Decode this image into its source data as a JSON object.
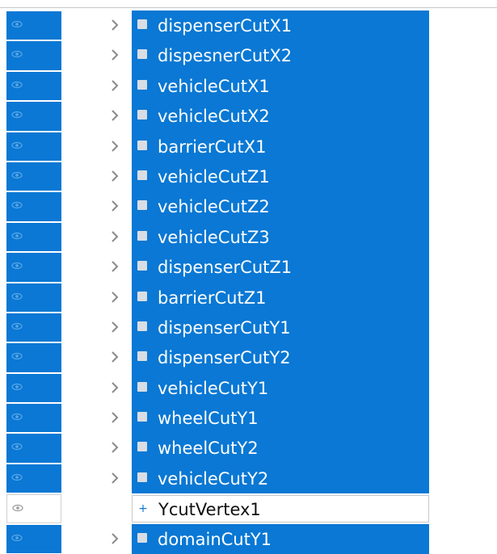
{
  "colors": {
    "selection": "#0a78d4",
    "text_selected": "#ffffff",
    "text_normal": "#111111"
  },
  "tree": {
    "items": [
      {
        "label": "dispenserCutX1",
        "icon": "cut-plane-icon",
        "selected": true,
        "expandable": true
      },
      {
        "label": "dispesnerCutX2",
        "icon": "cut-plane-icon",
        "selected": true,
        "expandable": true
      },
      {
        "label": "vehicleCutX1",
        "icon": "cut-plane-icon",
        "selected": true,
        "expandable": true
      },
      {
        "label": "vehicleCutX2",
        "icon": "cut-plane-icon",
        "selected": true,
        "expandable": true
      },
      {
        "label": "barrierCutX1",
        "icon": "cut-plane-icon",
        "selected": true,
        "expandable": true
      },
      {
        "label": "vehicleCutZ1",
        "icon": "cut-plane-icon",
        "selected": true,
        "expandable": true
      },
      {
        "label": "vehicleCutZ2",
        "icon": "cut-plane-icon",
        "selected": true,
        "expandable": true
      },
      {
        "label": "vehicleCutZ3",
        "icon": "cut-plane-icon",
        "selected": true,
        "expandable": true
      },
      {
        "label": "dispenserCutZ1",
        "icon": "cut-plane-icon",
        "selected": true,
        "expandable": true
      },
      {
        "label": "barrierCutZ1",
        "icon": "cut-plane-icon",
        "selected": true,
        "expandable": true
      },
      {
        "label": "dispenserCutY1",
        "icon": "cut-plane-icon",
        "selected": true,
        "expandable": true
      },
      {
        "label": "dispenserCutY2",
        "icon": "cut-plane-icon",
        "selected": true,
        "expandable": true
      },
      {
        "label": "vehicleCutY1",
        "icon": "cut-plane-icon",
        "selected": true,
        "expandable": true
      },
      {
        "label": "wheelCutY1",
        "icon": "cut-plane-icon",
        "selected": true,
        "expandable": true
      },
      {
        "label": "wheelCutY2",
        "icon": "cut-plane-icon",
        "selected": true,
        "expandable": true
      },
      {
        "label": "vehicleCutY2",
        "icon": "cut-plane-icon",
        "selected": true,
        "expandable": true
      },
      {
        "label": "YcutVertex1",
        "icon": "plus-icon",
        "selected": false,
        "expandable": false
      },
      {
        "label": "domainCutY1",
        "icon": "cut-plane-icon",
        "selected": true,
        "expandable": true
      }
    ]
  }
}
